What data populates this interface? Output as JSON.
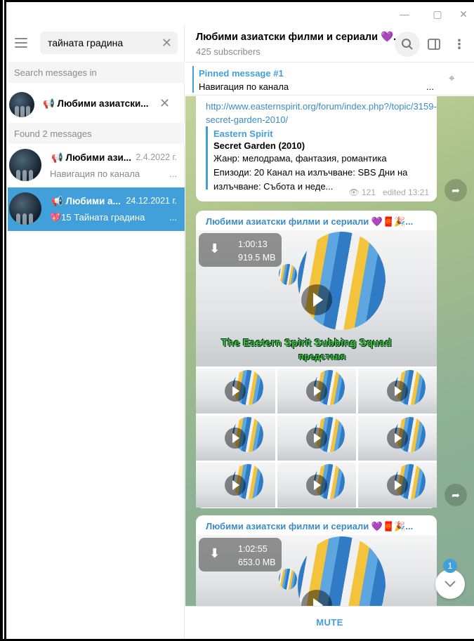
{
  "window": {
    "minimize": "—",
    "maximize": "▢",
    "close": "✕"
  },
  "search": {
    "value": "тайната градина",
    "clear_icon": "✕"
  },
  "labels": {
    "search_in": "Search messages in",
    "found": "Found 2 messages"
  },
  "filter": {
    "chat_name": "📢 Любими азиатски...",
    "remove_icon": "✕"
  },
  "results": [
    {
      "name": "📢 Любими ази...",
      "date": "2.4.2022 г.",
      "preview": "Навигация по канала",
      "dots": "..."
    },
    {
      "name": "📢 Любими а...",
      "date": "24.12.2021 г.",
      "preview": "💖15 Тайната градина",
      "dots": "..."
    }
  ],
  "chat": {
    "title": "Любими азиатски филми и сериали 💜...",
    "subscribers": "425 subscribers",
    "pinned_title": "Pinned message #1",
    "pinned_text": "Навигация по канала",
    "pinned_dots": "..."
  },
  "message1": {
    "link": "http://www.easternspirit.org/forum/index.php?/topic/3159-secret-garden-2010/",
    "site": "Eastern Spirit",
    "title": "Secret Garden (2010)",
    "desc1": "Жанр: мелодрама, фантазия, романтика",
    "desc2": "Епизоди: 20 Канал на излъчване: SBS Дни на",
    "desc3": "излъчване: Събота и неде...",
    "views": "121",
    "edited": "edited 13:21"
  },
  "message2": {
    "sender": "Любими азиатски филми и сериали 💜🧧🎉...",
    "duration": "1:00:13",
    "size": "919.5 MB",
    "overlay_text": "The Eastern Spirit Subbing Squad",
    "overlay_sub": "представя"
  },
  "message3": {
    "sender": "Любими азиатски филми и сериали 💜🧧🎉...",
    "duration": "1:02:55",
    "size": "653.0 MB"
  },
  "unread_count": "1",
  "mute_label": "MUTE",
  "icons": {
    "download": "⬇",
    "share": "➦",
    "views": "👁",
    "scroll_down": "⌄",
    "search": "⌕",
    "sidebar": "▯",
    "more": "⋮",
    "unpin": "⌖"
  }
}
